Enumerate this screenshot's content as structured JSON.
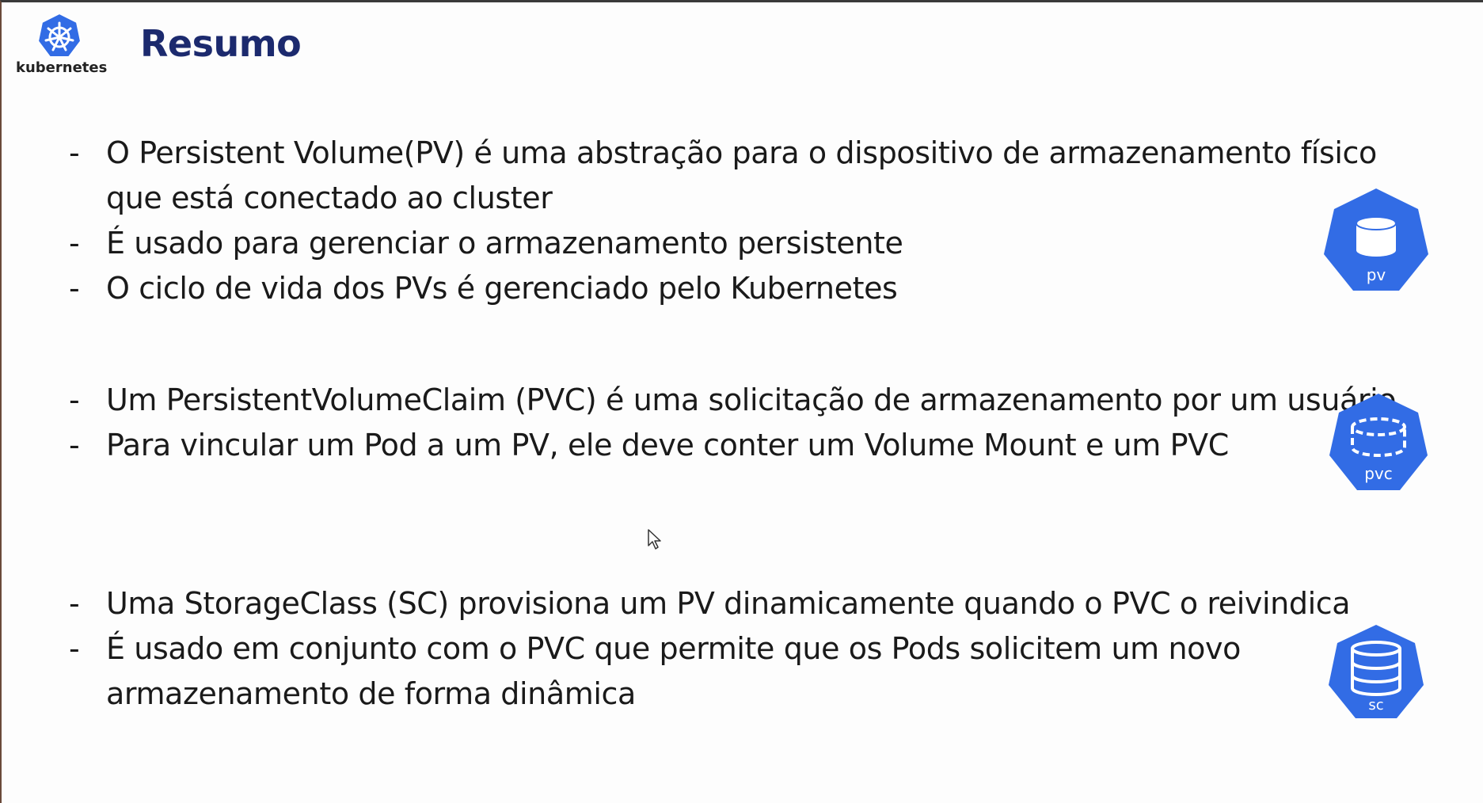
{
  "logo": {
    "text": "kubernetes",
    "icon": "helm-wheel-icon",
    "color": "#326ce5"
  },
  "title": "Resumo",
  "colors": {
    "title": "#1c2a6e",
    "icon": "#326ce5",
    "text": "#1a1a1a"
  },
  "groups": [
    {
      "icon": {
        "name": "pv-icon",
        "label": "pv"
      },
      "bullets": [
        {
          "dash": "-",
          "pre": "O ",
          "term": "Persistent Volume(PV)",
          "post": " é uma abstração para o dispositivo de armazenamento físico que está conectado ao cluster"
        },
        {
          "dash": "-",
          "pre": "É usado para gerenciar o armazenamento persistente",
          "term": "",
          "post": ""
        },
        {
          "dash": "-",
          "pre": "O ciclo de vida dos PVs é gerenciado pelo Kubernetes",
          "term": "",
          "post": ""
        }
      ]
    },
    {
      "icon": {
        "name": "pvc-icon",
        "label": "pvc"
      },
      "bullets": [
        {
          "dash": "-",
          "pre": "Um ",
          "term": "PersistentVolumeClaim (PVC)",
          "post": " é uma solicitação de armazenamento por um usuário."
        },
        {
          "dash": "-",
          "pre": "Para vincular um Pod a um PV, ele deve conter um Volume Mount e um PVC",
          "term": "",
          "post": ""
        }
      ]
    },
    {
      "icon": {
        "name": "sc-icon",
        "label": "sc"
      },
      "bullets": [
        {
          "dash": "-",
          "pre": "Uma ",
          "term": "StorageClass (SC)",
          "post": " provisiona um PV dinamicamente quando o PVC o reivindica"
        },
        {
          "dash": "-",
          "pre": "É usado em conjunto com o PVC que permite que os Pods solicitem um novo armazenamento de forma dinâmica",
          "term": "",
          "post": ""
        }
      ]
    }
  ]
}
